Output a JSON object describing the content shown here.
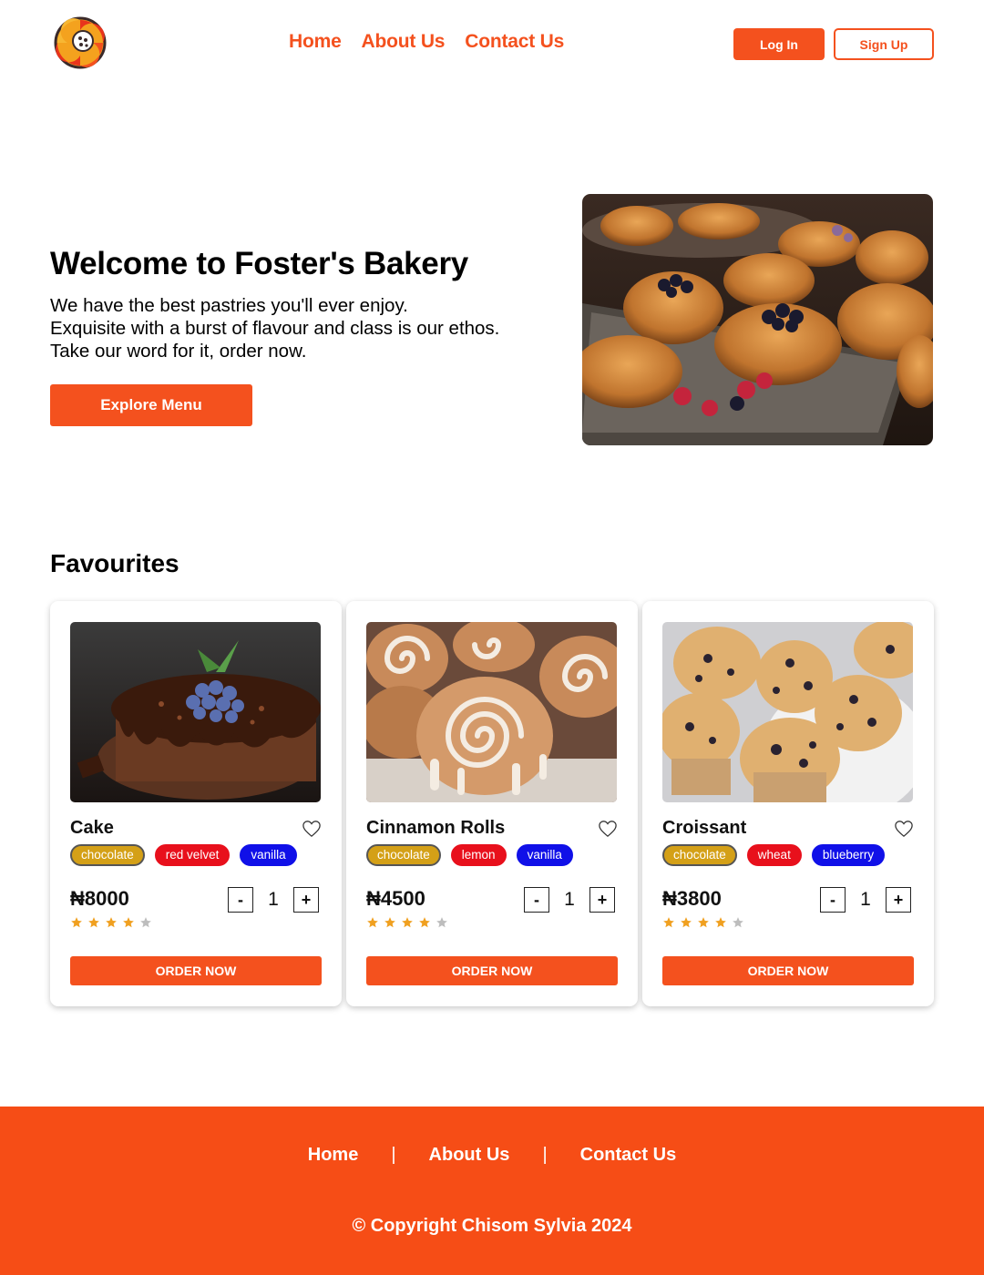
{
  "header": {
    "logo": "bakery-swirl-logo",
    "nav": [
      {
        "label": "Home"
      },
      {
        "label": "About Us"
      },
      {
        "label": "Contact Us"
      }
    ],
    "login_label": "Log In",
    "signup_label": "Sign Up"
  },
  "hero": {
    "title": "Welcome to Foster's Bakery",
    "lines": [
      "We have the best pastries you'll ever enjoy.",
      "Exquisite with a burst of flavour and class is our ethos.",
      "Take our word for it, order now."
    ],
    "cta_label": "Explore Menu",
    "image": "pastries-tray-photo"
  },
  "favourites": {
    "title": "Favourites",
    "order_label": "ORDER NOW",
    "items": [
      {
        "name": "Cake",
        "image": "chocolate-blueberry-cake-photo",
        "tags": [
          {
            "label": "chocolate",
            "color": "#d4a017"
          },
          {
            "label": "red velvet",
            "color": "#e8101c"
          },
          {
            "label": "vanilla",
            "color": "#1010e8"
          }
        ],
        "price": "₦8000",
        "quantity": "1",
        "rating": 4,
        "rating_max": 5
      },
      {
        "name": "Cinnamon Rolls",
        "image": "cinnamon-rolls-photo",
        "tags": [
          {
            "label": "chocolate",
            "color": "#d4a017"
          },
          {
            "label": "lemon",
            "color": "#e8101c"
          },
          {
            "label": "vanilla",
            "color": "#1010e8"
          }
        ],
        "price": "₦4500",
        "quantity": "1",
        "rating": 4,
        "rating_max": 5
      },
      {
        "name": "Croissant",
        "image": "blueberry-muffins-photo",
        "tags": [
          {
            "label": "chocolate",
            "color": "#d4a017"
          },
          {
            "label": "wheat",
            "color": "#e8101c"
          },
          {
            "label": "blueberry",
            "color": "#1010e8"
          }
        ],
        "price": "₦3800",
        "quantity": "1",
        "rating": 4,
        "rating_max": 5
      }
    ],
    "minus_label": "-",
    "plus_label": "+"
  },
  "footer": {
    "nav": [
      {
        "label": "Home"
      },
      {
        "label": "About Us"
      },
      {
        "label": "Contact Us"
      }
    ],
    "separator": "|",
    "copyright": "© Copyright Chisom Sylvia 2024"
  },
  "colors": {
    "brand": "#f4511e",
    "footer_bg": "#f64d16",
    "star_filled": "#f0a020",
    "star_empty": "#bdbdbd"
  }
}
